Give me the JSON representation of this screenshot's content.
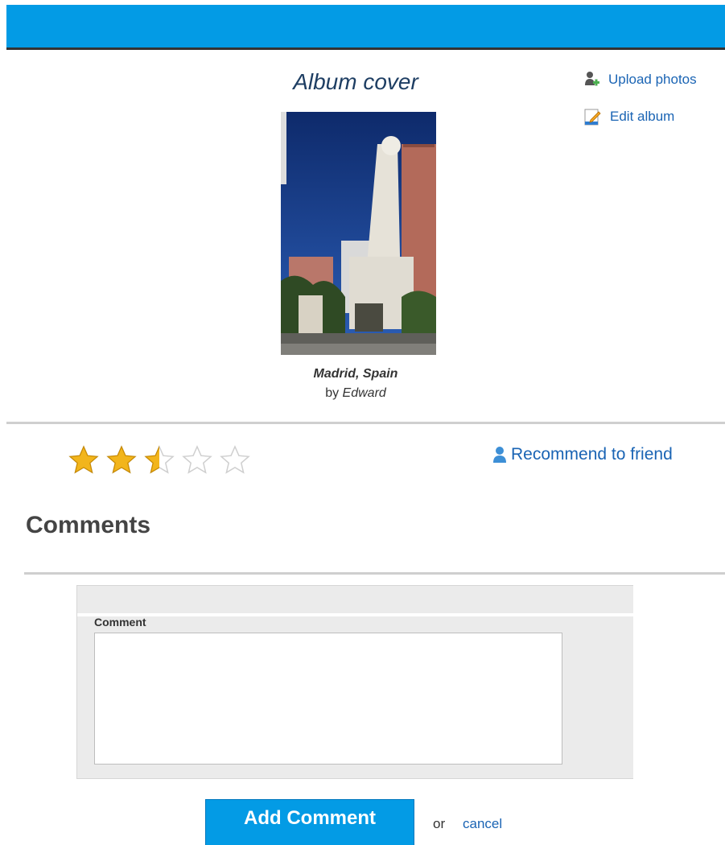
{
  "header": {
    "bar_color": "#039be5"
  },
  "album": {
    "heading": "Album cover",
    "cover_title": "Madrid, Spain",
    "by_label": "by",
    "author": "Edward"
  },
  "side_links": {
    "upload": "Upload photos",
    "upload_icon": "add-user-icon",
    "edit": "Edit album",
    "edit_icon": "edit-document-icon"
  },
  "rating": {
    "value": 2.5,
    "max": 5
  },
  "recommend": {
    "label": "Recommend to friend",
    "icon": "user-icon"
  },
  "comments": {
    "heading": "Comments",
    "field_label": "Comment",
    "field_value": "",
    "submit_label": "Add Comment",
    "or_text": "or",
    "cancel_label": "cancel"
  },
  "colors": {
    "link": "#1a64b4",
    "accent": "#039be5",
    "heading": "#1e3e63"
  }
}
